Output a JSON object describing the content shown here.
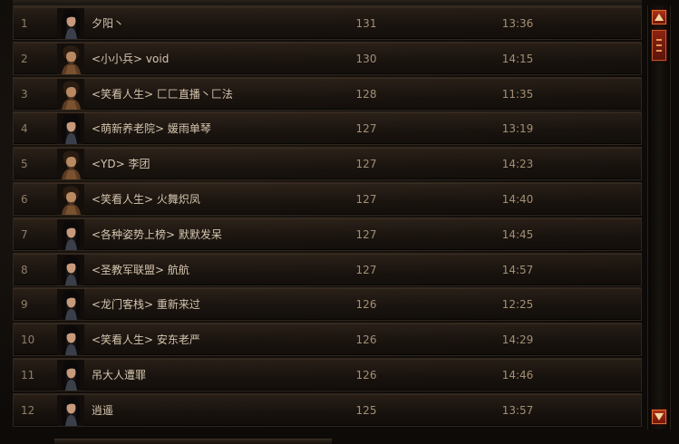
{
  "leaderboard": {
    "rows": [
      {
        "rank": "1",
        "name": "夕阳丶",
        "level": "131",
        "time": "13:36",
        "portrait": "female-portrait-icon"
      },
      {
        "rank": "2",
        "name": "<小小兵> void",
        "level": "130",
        "time": "14:15",
        "portrait": "male-portrait-icon"
      },
      {
        "rank": "3",
        "name": "<笑看人生> 匚匚直播丶匚法",
        "level": "128",
        "time": "11:35",
        "portrait": "male-portrait-icon"
      },
      {
        "rank": "4",
        "name": "<萌新养老院> 媛雨单琴",
        "level": "127",
        "time": "13:19",
        "portrait": "female-portrait-icon"
      },
      {
        "rank": "5",
        "name": "<YD> 李团",
        "level": "127",
        "time": "14:23",
        "portrait": "male-portrait-icon"
      },
      {
        "rank": "6",
        "name": "<笑看人生> 火舞炽凤",
        "level": "127",
        "time": "14:40",
        "portrait": "male-portrait-icon"
      },
      {
        "rank": "7",
        "name": "<各种姿势上榜> 默默发呆",
        "level": "127",
        "time": "14:45",
        "portrait": "female-portrait-icon"
      },
      {
        "rank": "8",
        "name": "<圣教军联盟> 航航",
        "level": "127",
        "time": "14:57",
        "portrait": "female-portrait-icon"
      },
      {
        "rank": "9",
        "name": "<龙门客栈> 重新来过",
        "level": "126",
        "time": "12:25",
        "portrait": "female-portrait-icon"
      },
      {
        "rank": "10",
        "name": "<笑看人生> 安东老严",
        "level": "126",
        "time": "14:29",
        "portrait": "female-portrait-icon"
      },
      {
        "rank": "11",
        "name": "吊大人遭罪",
        "level": "126",
        "time": "14:46",
        "portrait": "female-portrait-icon"
      },
      {
        "rank": "12",
        "name": "逍遥",
        "level": "125",
        "time": "13:57",
        "portrait": "female-portrait-icon"
      }
    ]
  },
  "scrollbar": {
    "up_icon": "arrow-up-icon",
    "down_icon": "arrow-down-icon",
    "accent": "#b3331a"
  },
  "colors": {
    "name_text": "#d4c4ad",
    "value_text": "#a38f74",
    "rank_text": "#8f7f69"
  }
}
